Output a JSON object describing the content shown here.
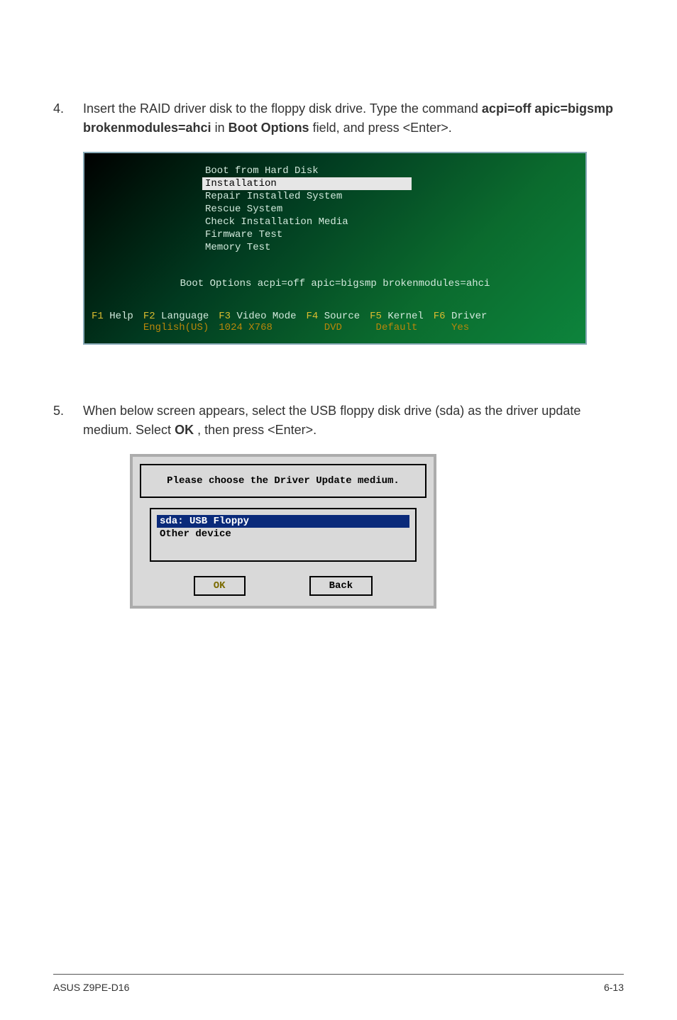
{
  "step4": {
    "num": "4.",
    "text_pre": "Insert the RAID driver disk to the floppy disk drive. Type the command ",
    "cmd": "acpi=off apic=bigsmp brokenmodules=ahci",
    "text_mid": " in ",
    "field": "Boot Options",
    "text_post": " field, and press <Enter>."
  },
  "boot": {
    "items": [
      "Boot from Hard Disk",
      "Installation",
      "Repair Installed System",
      "Rescue System",
      "Check Installation Media",
      "Firmware Test",
      "Memory Test"
    ],
    "selected_index": 1,
    "options_line": "Boot Options acpi=off apic=bigsmp brokenmodules=ahci",
    "fn": {
      "f1": {
        "key": "F1",
        "label": "Help"
      },
      "f2": {
        "key": "F2",
        "label": "Language",
        "sub": "English(US)"
      },
      "f3": {
        "key": "F3",
        "label": "Video Mode",
        "sub": "1024 X768"
      },
      "f4": {
        "key": "F4",
        "label": "Source",
        "sub": "DVD"
      },
      "f5": {
        "key": "F5",
        "label": "Kernel",
        "sub": "Default"
      },
      "f6": {
        "key": "F6",
        "label": "Driver",
        "sub": "Yes"
      }
    }
  },
  "step5": {
    "num": "5.",
    "text_pre": "When below screen appears, select the USB floppy disk drive (sda) as the driver update medium. Select ",
    "ok": "OK",
    "text_post": ", then press <Enter>."
  },
  "dialog": {
    "title": "Please choose the Driver Update medium.",
    "items": [
      "sda: USB Floppy",
      "Other device"
    ],
    "selected_index": 0,
    "ok": "OK",
    "back": "Back"
  },
  "footer": {
    "left": "ASUS Z9PE-D16",
    "right": "6-13"
  }
}
